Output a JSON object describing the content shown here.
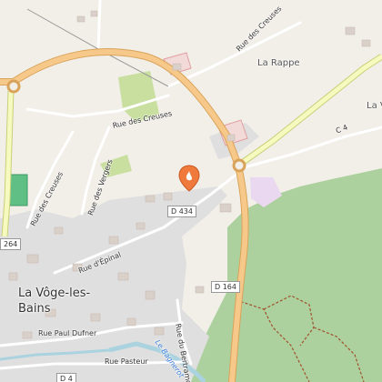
{
  "map": {
    "places": {
      "la_rappe": "La Rappe",
      "la_v_partial": "La V",
      "town": "La Vôge-les-\nBains"
    },
    "streets": {
      "rue_des_creuses_top": "Rue des Creuses",
      "rue_des_creuses_mid": "Rue des Creuses",
      "rue_des_creuses_left": "Rue des Creuses",
      "rue_des_vergers": "Rue des Vergers",
      "rue_d_epinal": "Rue d'Épinal",
      "rue_paul_dufner": "Rue Paul Dufner",
      "rue_pasteur": "Rue Pasteur",
      "rue_du_bertramont": "Rue du Bertramont"
    },
    "road_refs": {
      "d434": "D 434",
      "d164": "D 164",
      "c4": "C 4",
      "r264": "264",
      "d4": "D 4"
    },
    "water": {
      "river": "Le Bagnerot"
    },
    "marker": {
      "icon": "location-pin-icon",
      "color": "#f07a3c"
    },
    "colors": {
      "background": "#f2efe9",
      "main_road": "#f6c98a",
      "main_road_casing": "#d9a35a",
      "secondary_road": "#f7fabf",
      "forest": "#add19e",
      "residential": "#e0dfdf",
      "building": "#d9d0c9",
      "water": "#aad3df",
      "path": "#a0522d"
    }
  }
}
